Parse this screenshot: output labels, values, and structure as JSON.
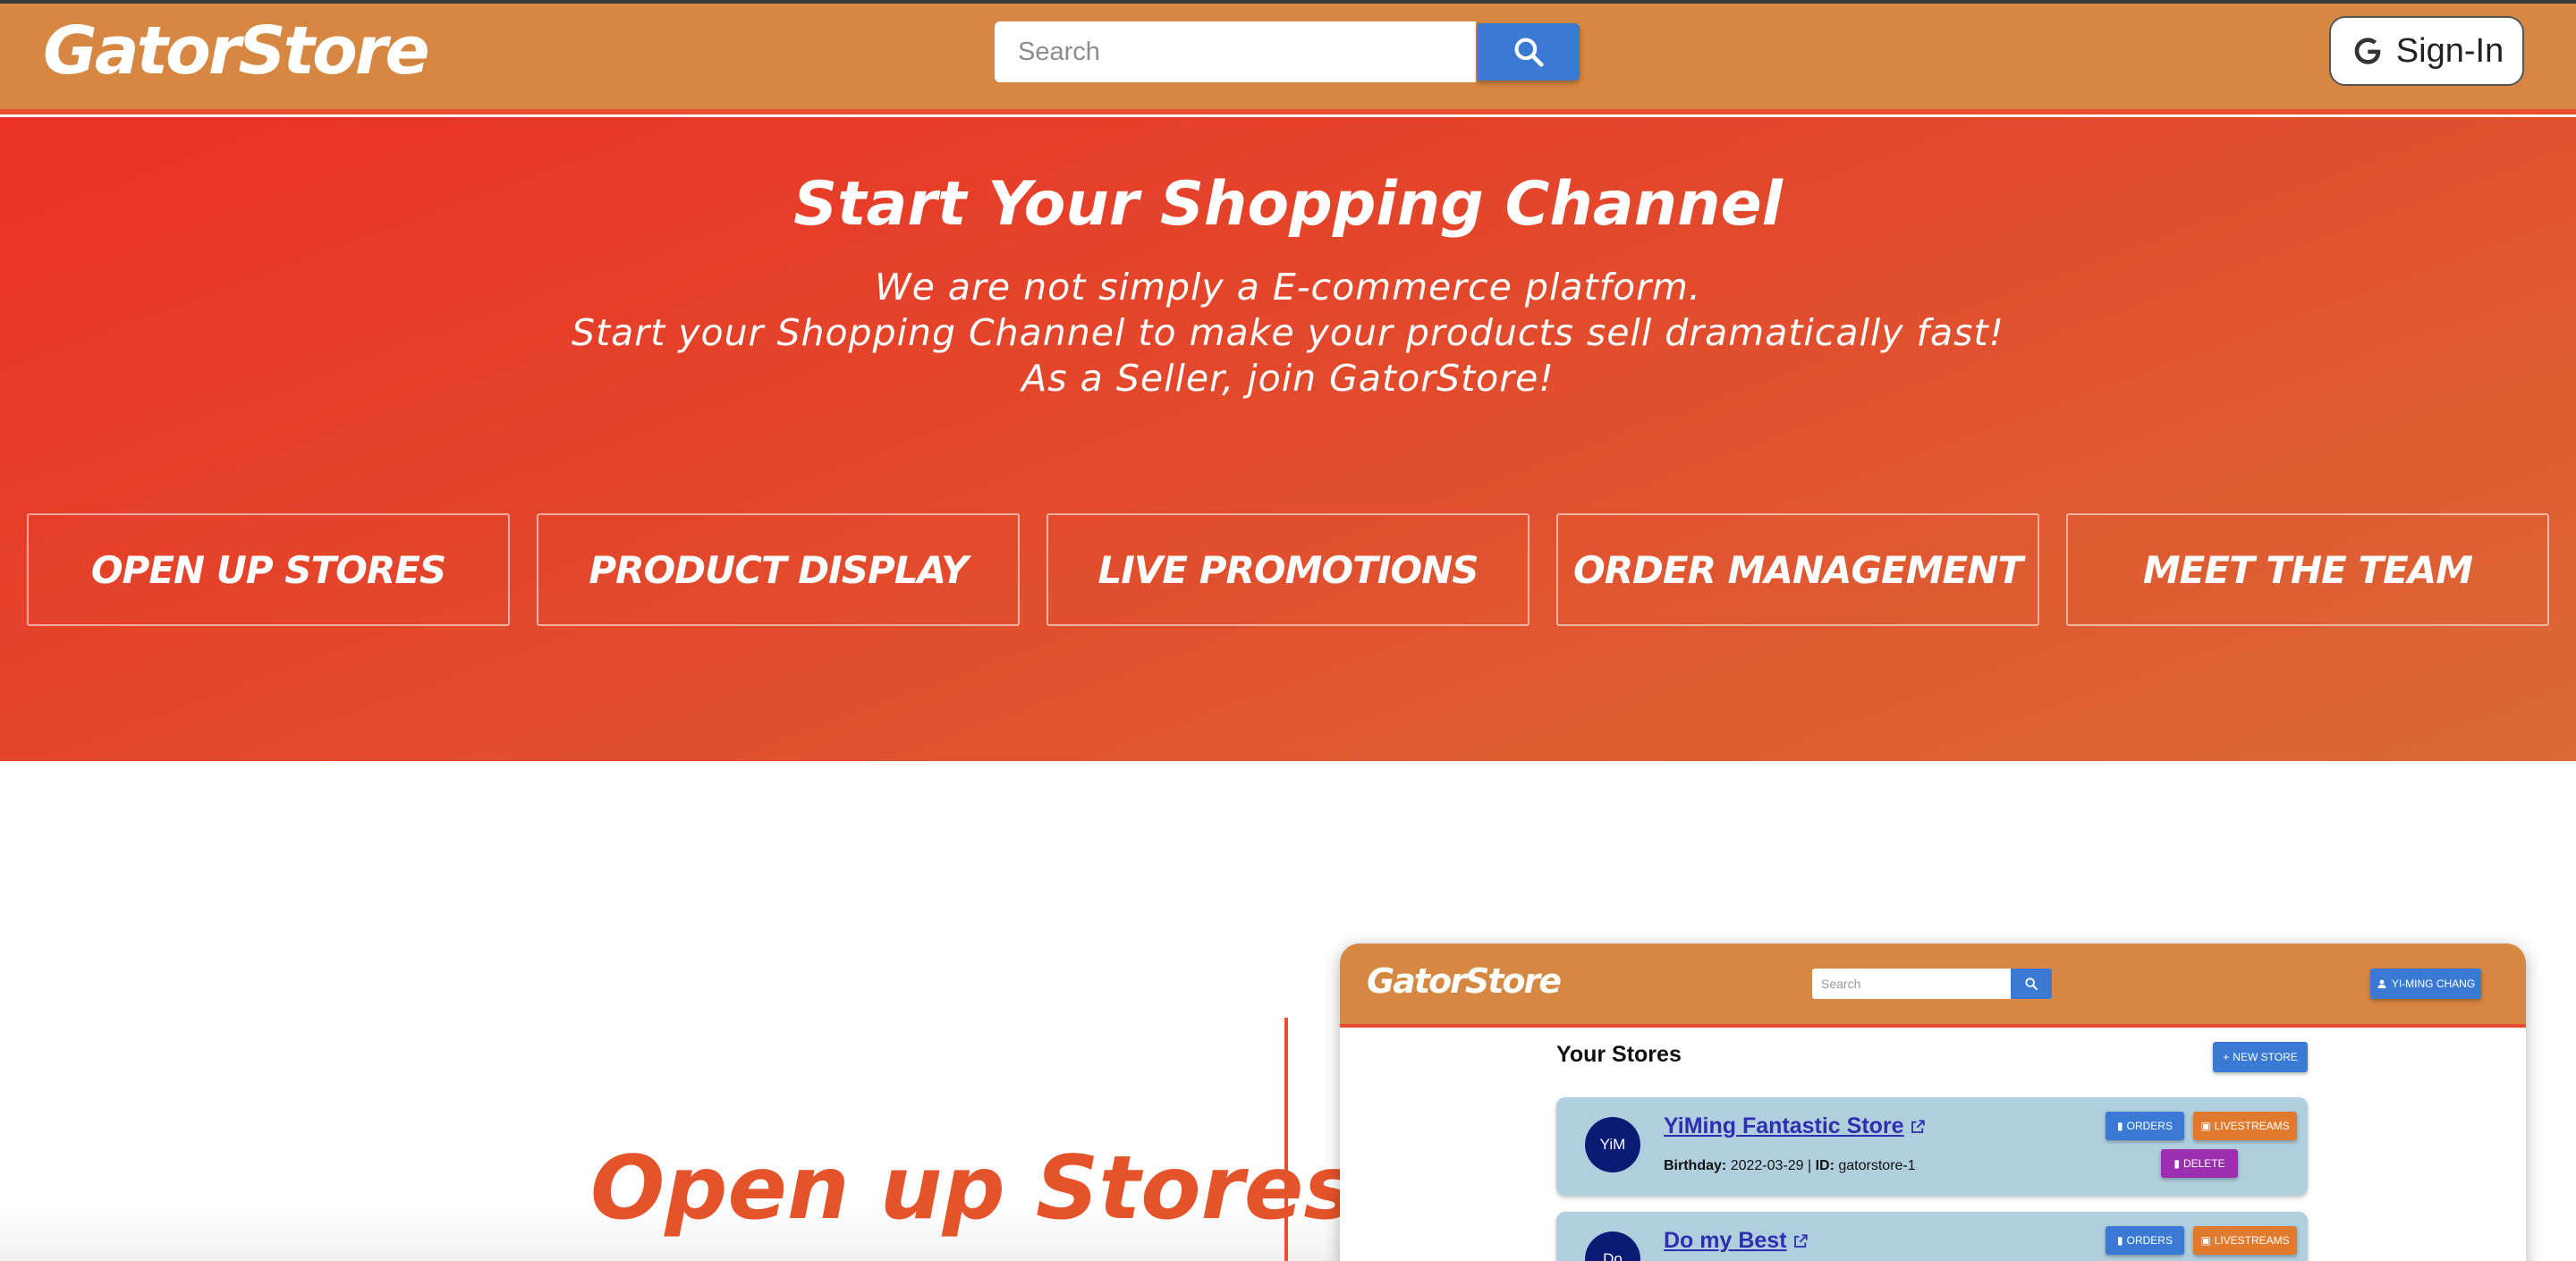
{
  "header": {
    "logo": "GatorStore",
    "search_placeholder": "Search",
    "signin_label": "Sign-In"
  },
  "hero": {
    "title": "Start Your Shopping Channel",
    "line1": "We are not simply a E-commerce platform.",
    "line2": "Start your Shopping Channel to make your products sell dramatically fast!",
    "line3": "As a Seller, join GatorStore!",
    "features": [
      "OPEN UP STORES",
      "PRODUCT DISPLAY",
      "LIVE PROMOTIONS",
      "ORDER MANAGEMENT",
      "MEET THE TEAM"
    ]
  },
  "section": {
    "title": "Open up Stores"
  },
  "preview": {
    "logo": "GatorStore",
    "search_placeholder": "Search",
    "user_label": "YI-MING CHANG",
    "heading": "Your Stores",
    "new_store_label": "NEW STORE",
    "stores": [
      {
        "avatar": "YiM",
        "name": "YiMing Fantastic Store",
        "birthday_label": "Birthday:",
        "birthday": "2022-03-29",
        "id_label": "ID:",
        "id": "gatorstore-1",
        "orders_label": "ORDERS",
        "livestreams_label": "LIVESTREAMS",
        "delete_label": "DELETE"
      },
      {
        "avatar": "Do",
        "name": "Do my Best",
        "orders_label": "ORDERS",
        "livestreams_label": "LIVESTREAMS"
      }
    ]
  },
  "colors": {
    "nav_bg": "#d68741",
    "accent_red": "#e5532a",
    "primary_blue": "#3a7ad4",
    "avatar_navy": "#0b1a75",
    "store_card_bg": "#b0cfde"
  },
  "icons": [
    "search-icon",
    "google-icon",
    "user-icon",
    "plus-icon",
    "external-link-icon",
    "clipboard-icon",
    "livestream-icon",
    "trash-icon"
  ]
}
